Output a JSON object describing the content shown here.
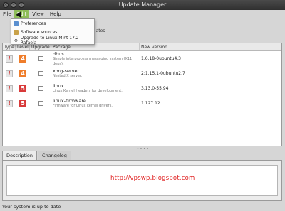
{
  "window": {
    "title": "Update Manager"
  },
  "menubar": {
    "items": [
      "File",
      "Edit",
      "View",
      "Help"
    ]
  },
  "edit_menu": {
    "items": [
      "Preferences",
      "Software sources",
      "Upgrade to Linux Mint 17.2 Rafaela"
    ]
  },
  "toolbar": {
    "partial_left": "C",
    "partial_right": "ates"
  },
  "table": {
    "headers": [
      "Type",
      "Level",
      "Upgrade",
      "Package",
      "New version"
    ],
    "rows": [
      {
        "type": "!",
        "level": "4",
        "level_color": "#ef7d2b",
        "name": "dbus",
        "desc": "Simple interprocess messaging system (X11 deps).",
        "version": "1.6.18-0ubuntu4.3"
      },
      {
        "type": "!",
        "level": "4",
        "level_color": "#ef7d2b",
        "name": "xorg-server",
        "desc": "Nested X server.",
        "version": "2:1.15.1-0ubuntu2.7"
      },
      {
        "type": "!",
        "level": "5",
        "level_color": "#d83a3a",
        "name": "linux",
        "desc": "Linux Kernel Headers for development.",
        "version": "3.13.0-55.94"
      },
      {
        "type": "!",
        "level": "5",
        "level_color": "#d83a3a",
        "name": "linux-firmware",
        "desc": "Firmware for Linux kernel drivers.",
        "version": "1.127.12"
      }
    ]
  },
  "tabs": [
    "Description",
    "Changelog"
  ],
  "watermark": "http://vpswp.blogspot.com",
  "status": "Your system is up to date"
}
